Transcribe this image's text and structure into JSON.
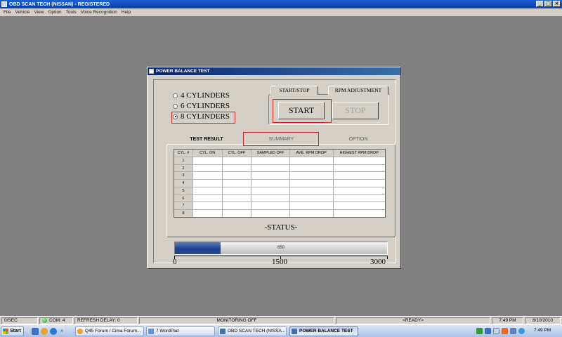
{
  "app": {
    "title": "OBD SCAN TECH (NISSAN) - REGISTERED",
    "menu": [
      "File",
      "Vehicle",
      "View",
      "Option",
      "Tools",
      "Voice Recognition",
      "Help"
    ]
  },
  "dialog": {
    "title": "POWER BALANCE TEST",
    "cylinders": {
      "options": [
        "4 CYLINDERS",
        "6 CYLINDERS",
        "8 CYLINDERS"
      ],
      "selected": "8 CYLINDERS"
    },
    "control_tabs": [
      "START/STOP",
      "RPM ADJUSTMENT"
    ],
    "start_label": "START",
    "stop_label": "STOP",
    "result_tabs": [
      "TEST RESULT",
      "SUMMARY",
      "OPTION"
    ],
    "table": {
      "headers": [
        "CYL. #",
        "CYL. ON",
        "CYL. OFF",
        "SAMPLED OFF",
        "AVE. RPM DROP",
        "HIGHEST RPM DROP"
      ],
      "row_labels": [
        "1",
        "2",
        "3",
        "4",
        "5",
        "6",
        "7",
        "8"
      ]
    },
    "status_label": "-STATUS-",
    "rpm_gauge": {
      "value_text": "650",
      "value": 650,
      "min": 0,
      "max": 3000,
      "labels": [
        "0",
        "1500",
        "3000"
      ]
    },
    "accent": "#d3202a"
  },
  "statusbar": {
    "rate": "0/SEC",
    "com": "COM:  4",
    "refresh": "REFRESH DELAY:  0",
    "monitoring": "MONITORING OFF",
    "ready": "<READY>",
    "time": "7:49 PM",
    "date": "8/10/2010"
  },
  "taskbar": {
    "start": "Start",
    "tasks": [
      "Q45 Forum / Cima Forum...",
      "7 WordPad",
      "OBD SCAN TECH (NISSA...",
      "POWER BALANCE TEST"
    ],
    "clock": "7:49 PM"
  }
}
